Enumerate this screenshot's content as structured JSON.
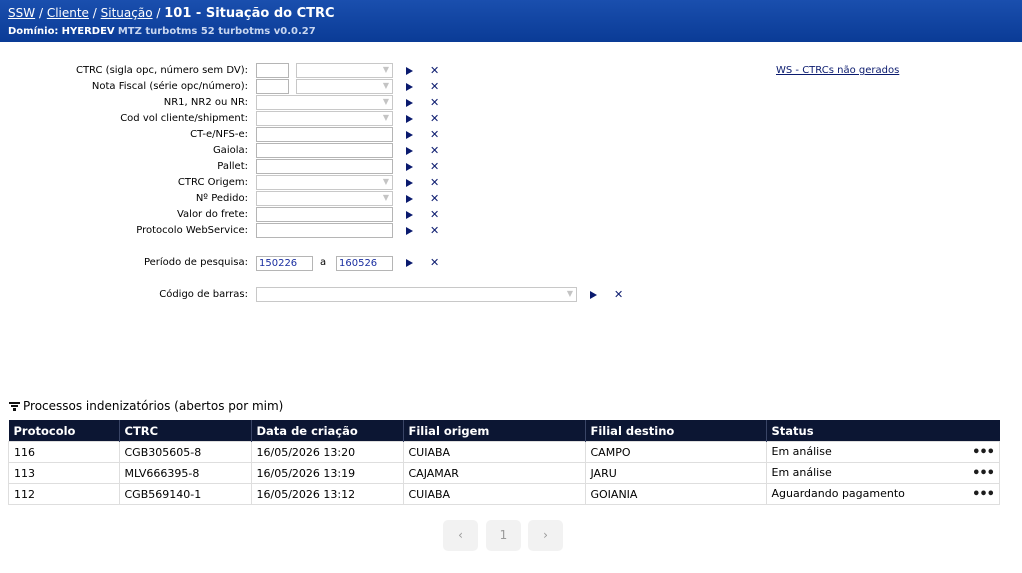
{
  "header": {
    "breadcrumb": [
      "SSW",
      "Cliente",
      "Situação"
    ],
    "separator": "/",
    "title": "101 - Situação do CTRC",
    "domain_label": "Domínio:",
    "domain_name": "HYERDEV",
    "domain_rest": "MTZ turbotms 52 turbotms v0.0.27"
  },
  "form": {
    "ctrc_label": "CTRC (sigla opc, número sem DV):",
    "nota_label": "Nota Fiscal (série opc/número):",
    "nr_label": "NR1, NR2 ou NR:",
    "codvol_label": "Cod vol cliente/shipment:",
    "cte_label": "CT-e/NFS-e:",
    "gaiola_label": "Gaiola:",
    "pallet_label": "Pallet:",
    "ctrc_origem_label": "CTRC Origem:",
    "pedido_label": "Nº Pedido:",
    "frete_label": "Valor do frete:",
    "protocolo_label": "Protocolo WebService:",
    "periodo_label": "Período de pesquisa:",
    "periodo_from": "150226",
    "periodo_sep": "a",
    "periodo_to": "160526",
    "barras_label": "Código de barras:",
    "ws_link": "WS - CTRCs não gerados"
  },
  "section": {
    "title": "Processos indenizatórios (abertos por mim)"
  },
  "table": {
    "columns": [
      "Protocolo",
      "CTRC",
      "Data de criação",
      "Filial origem",
      "Filial destino",
      "Status"
    ],
    "rows": [
      [
        "116",
        "CGB305605-8",
        "16/05/2026 13:20",
        "CUIABA",
        "CAMPO",
        "Em análise"
      ],
      [
        "113",
        "MLV666395-8",
        "16/05/2026 13:19",
        "CAJAMAR",
        "JARU",
        "Em análise"
      ],
      [
        "112",
        "CGB569140-1",
        "16/05/2026 13:12",
        "CUIABA",
        "GOIANIA",
        "Aguardando pagamento"
      ]
    ],
    "row_menu": "•••"
  },
  "pagination": {
    "prev": "‹",
    "page": "1",
    "next": "›"
  },
  "colors": {
    "header_bg": "#0a3b96",
    "table_header_bg": "#0c1633",
    "action_icon": "#0a1a6e"
  }
}
